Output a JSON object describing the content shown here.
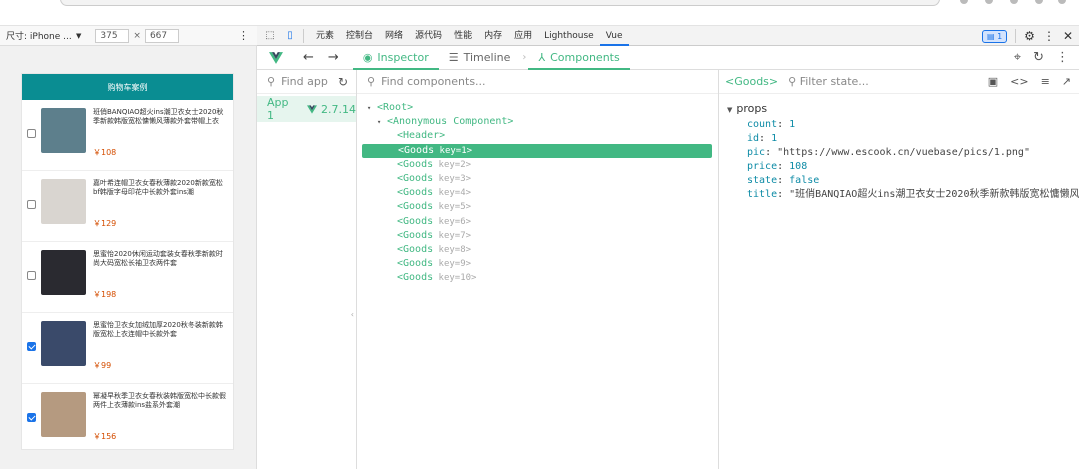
{
  "device_toolbar": {
    "size_label": "尺寸: iPhone ...",
    "width": "375",
    "times": "×",
    "height": "667"
  },
  "devtools_tabs": [
    "元素",
    "控制台",
    "网络",
    "源代码",
    "性能",
    "内存",
    "应用",
    "Lighthouse",
    "Vue"
  ],
  "devtools_active_tab": "Vue",
  "issues_badge": "1",
  "vue_toolbar": {
    "inspector": "Inspector",
    "timeline": "Timeline",
    "components": "Components"
  },
  "app_panel": {
    "search_placeholder": "Find app",
    "app_name": "App 1",
    "vue_version": "2.7.14"
  },
  "tree_panel": {
    "search_placeholder": "Find components...",
    "rows": [
      {
        "text": "<Root>",
        "key": "",
        "indent": 0,
        "arrow": "▾",
        "selected": false
      },
      {
        "text": "<Anonymous Component>",
        "key": "",
        "indent": 1,
        "arrow": "▾",
        "selected": false
      },
      {
        "text": "<Header>",
        "key": "",
        "indent": 2,
        "arrow": "",
        "selected": false
      },
      {
        "text": "<Goods",
        "key": " key=1>",
        "indent": 2,
        "arrow": "",
        "selected": true
      },
      {
        "text": "<Goods",
        "key": " key=2>",
        "indent": 2,
        "arrow": "",
        "selected": false
      },
      {
        "text": "<Goods",
        "key": " key=3>",
        "indent": 2,
        "arrow": "",
        "selected": false
      },
      {
        "text": "<Goods",
        "key": " key=4>",
        "indent": 2,
        "arrow": "",
        "selected": false
      },
      {
        "text": "<Goods",
        "key": " key=5>",
        "indent": 2,
        "arrow": "",
        "selected": false
      },
      {
        "text": "<Goods",
        "key": " key=6>",
        "indent": 2,
        "arrow": "",
        "selected": false
      },
      {
        "text": "<Goods",
        "key": " key=7>",
        "indent": 2,
        "arrow": "",
        "selected": false
      },
      {
        "text": "<Goods",
        "key": " key=8>",
        "indent": 2,
        "arrow": "",
        "selected": false
      },
      {
        "text": "<Goods",
        "key": " key=9>",
        "indent": 2,
        "arrow": "",
        "selected": false
      },
      {
        "text": "<Goods",
        "key": " key=10>",
        "indent": 2,
        "arrow": "",
        "selected": false
      }
    ]
  },
  "state_panel": {
    "component_name": "<Goods>",
    "filter_placeholder": "Filter state...",
    "section": "props",
    "props": [
      {
        "key": "count",
        "value": "1",
        "type": "n"
      },
      {
        "key": "id",
        "value": "1",
        "type": "n"
      },
      {
        "key": "pic",
        "value": "\"https://www.escook.cn/vuebase/pics/1.png\"",
        "type": "s"
      },
      {
        "key": "price",
        "value": "108",
        "type": "n"
      },
      {
        "key": "state",
        "value": "false",
        "type": "b"
      },
      {
        "key": "title",
        "value": "\"班俏BANQIAO超火ins潮卫衣女士2020秋季新款韩版宽松慵懒风",
        "type": "s"
      }
    ]
  },
  "phone": {
    "header": "购物车案例",
    "goods": [
      {
        "title": "班俏BANQIAO超火ins潮卫衣女士2020秋季新款韩版宽松慵懒风薄款外套带帽上衣",
        "price": "￥108",
        "checked": false,
        "thumb": "#5d7f8c"
      },
      {
        "title": "嘉叶希连帽卫衣女春秋薄款2020新款宽松bf韩版字母印花中长款外套ins潮",
        "price": "￥129",
        "checked": false,
        "thumb": "#d9d5d0"
      },
      {
        "title": "思蜜怡2020休闲运动套装女春秋季新款时尚大码宽松长袖卫衣两件套",
        "price": "￥198",
        "checked": false,
        "thumb": "#2a2a30"
      },
      {
        "title": "思蜜怡卫衣女加绒加厚2020秋冬装新款韩版宽松上衣连帽中长款外套",
        "price": "￥99",
        "checked": true,
        "thumb": "#3a4a6a"
      },
      {
        "title": "幂凝早秋季卫衣女春秋装韩版宽松中长款假两件上衣薄款ins盐系外套潮",
        "price": "￥156",
        "checked": true,
        "thumb": "#b59a80"
      }
    ]
  }
}
